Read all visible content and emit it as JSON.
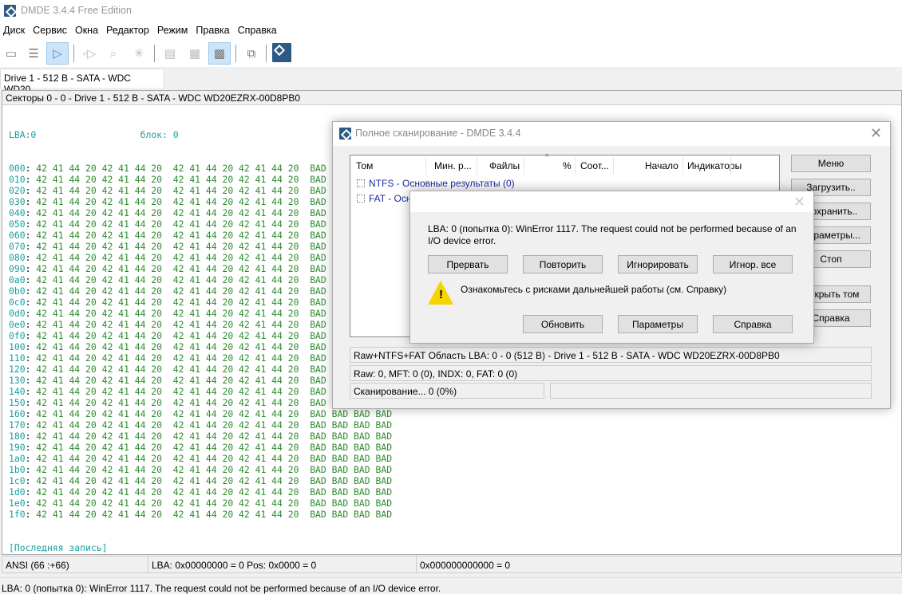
{
  "app": {
    "title": "DMDE 3.4.4 Free Edition"
  },
  "menu": [
    "Диск",
    "Сервис",
    "Окна",
    "Редактор",
    "Режим",
    "Правка",
    "Справка"
  ],
  "tab": "Drive 1 - 512 B - SATA - WDC WD20...",
  "editor": {
    "header": "Секторы 0 - 0 - Drive 1 - 512 B - SATA - WDC WD20EZRX-00D8PB0",
    "lba_label": "LBA:0",
    "block_label": "блок: 0",
    "rows": {
      "offsets": [
        "000",
        "010",
        "020",
        "030",
        "040",
        "050",
        "060",
        "070",
        "080",
        "090",
        "0a0",
        "0b0",
        "0c0",
        "0d0",
        "0e0",
        "0f0",
        "100",
        "110",
        "120",
        "130",
        "140",
        "150",
        "160",
        "170",
        "180",
        "190",
        "1a0",
        "1b0",
        "1c0",
        "1d0",
        "1e0",
        "1f0"
      ],
      "hex": "42 41 44 20 42 41 44 20  42 41 44 20 42 41 44 20",
      "text": "BAD BAD BAD BAD"
    },
    "end_label": "[Последняя запись]"
  },
  "status": {
    "encoding": "ANSI (66 :+66)",
    "position": "LBA: 0x00000000 = 0  Pos: 0x0000 = 0",
    "value": "0x000000000000 = 0"
  },
  "message": "LBA: 0 (попытка 0): WinError 1117. The request could not be performed because of an I/O device error.",
  "scan_dialog": {
    "title": "Полное сканирование - DMDE 3.4.4",
    "columns": [
      "Том",
      "Мин. р...",
      "Файлы",
      "%",
      "Соот...",
      "Начало",
      "Индикаторы"
    ],
    "items": [
      "NTFS - Основные результаты (0)",
      "FAT - Основные результаты (0)"
    ],
    "buttons": [
      "Меню",
      "Загрузить..",
      "Сохранить..",
      "Параметры...",
      "Стоп",
      "Открыть том",
      "Справка"
    ],
    "area": "Raw+NTFS+FAT Область LBA: 0 - 0 (512 B) - Drive 1 - 512 B - SATA - WDC WD20EZRX-00D8PB0",
    "counts": "Raw: 0, MFT: 0 (0), INDX: 0, FAT: 0 (0)",
    "progress_text": "Сканирование... 0 (0%)",
    "progress_percent": 0
  },
  "error_dialog": {
    "message": "LBA: 0 (попытка 0): WinError 1117. The request could not be performed because of an I/O device error.",
    "buttons_top": [
      "Прервать",
      "Повторить",
      "Игнорировать",
      "Игнор. все"
    ],
    "warning": "Ознакомьтесь с рисками дальнейшей работы (см. Справку)",
    "buttons_bottom": [
      "Обновить",
      "Параметры",
      "Справка"
    ]
  }
}
